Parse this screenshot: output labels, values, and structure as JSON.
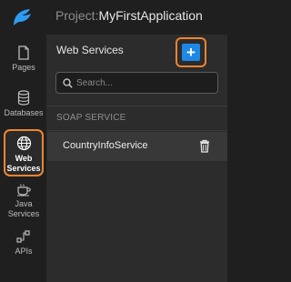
{
  "header": {
    "project_label": "Project:",
    "project_name": "MyFirstApplication"
  },
  "rail": {
    "items": [
      {
        "label": "Pages",
        "icon": "page-icon"
      },
      {
        "label": "Databases",
        "icon": "database-icon"
      },
      {
        "label_line1": "Web",
        "label_line2": "Services",
        "icon": "globe-icon",
        "selected": true
      },
      {
        "label_line1": "Java",
        "label_line2": "Services",
        "icon": "coffee-icon"
      },
      {
        "label": "APIs",
        "icon": "api-icon"
      }
    ]
  },
  "panel": {
    "title": "Web Services",
    "add_label": "+",
    "search_placeholder": "Search...",
    "section_title": "SOAP SERVICE",
    "services": [
      {
        "name": "CountryInfoService"
      }
    ]
  },
  "colors": {
    "accent_orange": "#ef8531",
    "primary_blue": "#1e88e5",
    "background": "#1f1f1f",
    "panel": "#2c2c2c"
  }
}
